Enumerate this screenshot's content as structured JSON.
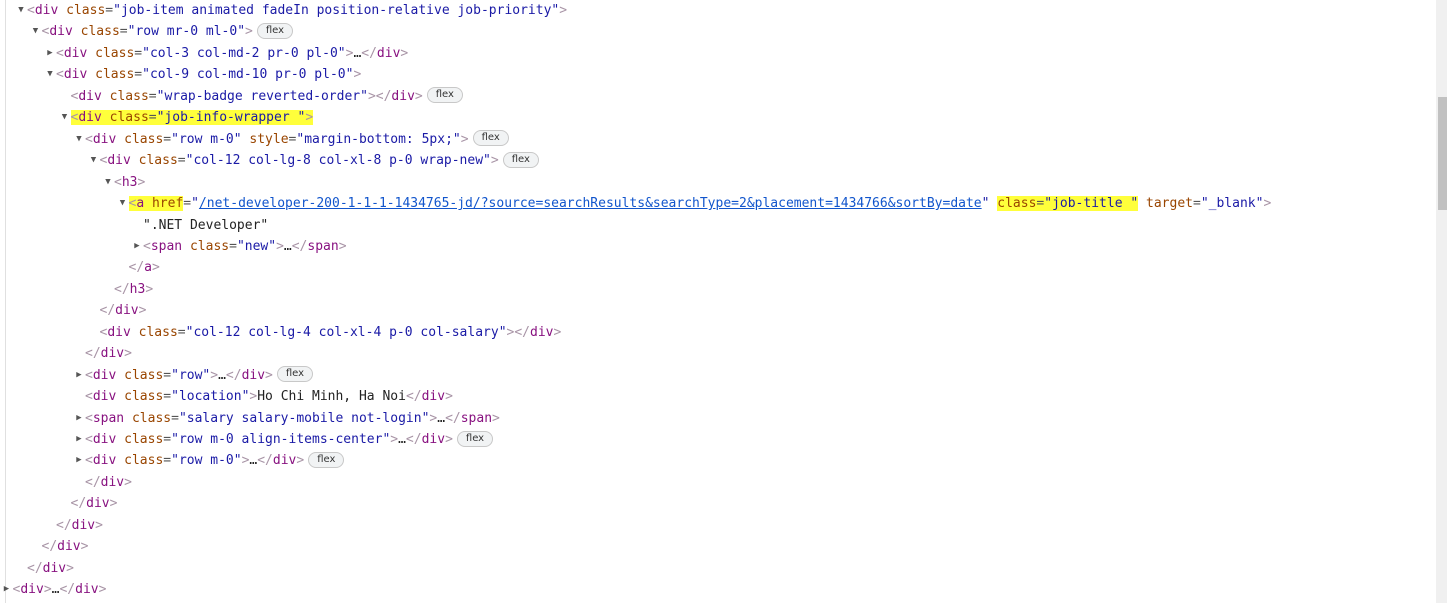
{
  "lines": [
    {
      "indent": 0,
      "toggle": "open",
      "kind": "open",
      "tag": "div",
      "attrs": [
        {
          "name": "class",
          "value": "job-item animated fadeIn position-relative job-priority"
        }
      ],
      "collapsed": false,
      "badge": null
    },
    {
      "indent": 1,
      "toggle": "open",
      "kind": "open",
      "tag": "div",
      "attrs": [
        {
          "name": "class",
          "value": "row mr-0 ml-0"
        }
      ],
      "badge": "flex"
    },
    {
      "indent": 2,
      "toggle": "closed",
      "kind": "collapsed",
      "tag": "div",
      "attrs": [
        {
          "name": "class",
          "value": "col-3 col-md-2 pr-0 pl-0"
        }
      ],
      "badge": null
    },
    {
      "indent": 2,
      "toggle": "open",
      "kind": "open",
      "tag": "div",
      "attrs": [
        {
          "name": "class",
          "value": "col-9 col-md-10 pr-0 pl-0"
        }
      ],
      "badge": null
    },
    {
      "indent": 3,
      "toggle": "none",
      "kind": "empty",
      "tag": "div",
      "attrs": [
        {
          "name": "class",
          "value": "wrap-badge reverted-order"
        }
      ],
      "badge": "flex"
    },
    {
      "indent": 3,
      "toggle": "open",
      "kind": "open",
      "tag": "div",
      "attrs": [
        {
          "name": "class",
          "value": "job-info-wrapper "
        }
      ],
      "badge": null,
      "highlight": "all"
    },
    {
      "indent": 4,
      "toggle": "open",
      "kind": "open",
      "tag": "div",
      "attrs": [
        {
          "name": "class",
          "value": "row m-0"
        },
        {
          "name": "style",
          "value": "margin-bottom: 5px;"
        }
      ],
      "badge": "flex"
    },
    {
      "indent": 5,
      "toggle": "open",
      "kind": "open",
      "tag": "div",
      "attrs": [
        {
          "name": "class",
          "value": "col-12 col-lg-8 col-xl-8 p-0 wrap-new"
        }
      ],
      "badge": "flex"
    },
    {
      "indent": 6,
      "toggle": "open",
      "kind": "open",
      "tag": "h3",
      "attrs": [],
      "badge": null
    },
    {
      "indent": 7,
      "toggle": "open",
      "kind": "open",
      "tag": "a",
      "attrs": [
        {
          "name": "href",
          "value": "/net-developer-200-1-1-1-1434765-jd/?source=searchResults&searchType=2&placement=1434766&sortBy=date",
          "link": true,
          "highlight_name": true
        },
        {
          "name": "class",
          "value": "job-title ",
          "highlight_attr": true
        },
        {
          "name": "target",
          "value": "_blank"
        }
      ],
      "badge": null,
      "highlight_tag": true
    },
    {
      "indent": 8,
      "toggle": "none",
      "kind": "text",
      "text": "\".NET Developer\""
    },
    {
      "indent": 8,
      "toggle": "closed",
      "kind": "collapsed",
      "tag": "span",
      "attrs": [
        {
          "name": "class",
          "value": "new"
        }
      ],
      "badge": null
    },
    {
      "indent": 7,
      "toggle": "none",
      "kind": "close",
      "tag": "a"
    },
    {
      "indent": 6,
      "toggle": "none",
      "kind": "close",
      "tag": "h3"
    },
    {
      "indent": 5,
      "toggle": "none",
      "kind": "close",
      "tag": "div"
    },
    {
      "indent": 5,
      "toggle": "none",
      "kind": "empty",
      "tag": "div",
      "attrs": [
        {
          "name": "class",
          "value": "col-12 col-lg-4 col-xl-4 p-0 col-salary"
        }
      ],
      "badge": null
    },
    {
      "indent": 4,
      "toggle": "none",
      "kind": "close",
      "tag": "div"
    },
    {
      "indent": 4,
      "toggle": "closed",
      "kind": "collapsed",
      "tag": "div",
      "attrs": [
        {
          "name": "class",
          "value": "row"
        }
      ],
      "badge": "flex"
    },
    {
      "indent": 4,
      "toggle": "none",
      "kind": "inline",
      "tag": "div",
      "attrs": [
        {
          "name": "class",
          "value": "location"
        }
      ],
      "text": "Ho Chi Minh, Ha Noi",
      "badge": null
    },
    {
      "indent": 4,
      "toggle": "closed",
      "kind": "collapsed",
      "tag": "span",
      "attrs": [
        {
          "name": "class",
          "value": "salary salary-mobile not-login"
        }
      ],
      "badge": null
    },
    {
      "indent": 4,
      "toggle": "closed",
      "kind": "collapsed",
      "tag": "div",
      "attrs": [
        {
          "name": "class",
          "value": "row m-0 align-items-center"
        }
      ],
      "badge": "flex"
    },
    {
      "indent": 4,
      "toggle": "closed",
      "kind": "collapsed",
      "tag": "div",
      "attrs": [
        {
          "name": "class",
          "value": "row m-0"
        }
      ],
      "badge": "flex"
    },
    {
      "indent": 4,
      "toggle": "none",
      "kind": "close",
      "tag": "div"
    },
    {
      "indent": 3,
      "toggle": "none",
      "kind": "close",
      "tag": "div"
    },
    {
      "indent": 2,
      "toggle": "none",
      "kind": "close",
      "tag": "div"
    },
    {
      "indent": 1,
      "toggle": "none",
      "kind": "close",
      "tag": "div"
    },
    {
      "indent": 0,
      "toggle": "none",
      "kind": "close",
      "tag": "div"
    },
    {
      "indent": -1,
      "toggle": "closed",
      "kind": "collapsed",
      "tag": "div",
      "attrs": [],
      "badge": null
    }
  ],
  "ellipsis": "…",
  "scrollbar": {
    "thumb_fraction_start": 0.16,
    "thumb_fraction_size": 0.19
  }
}
